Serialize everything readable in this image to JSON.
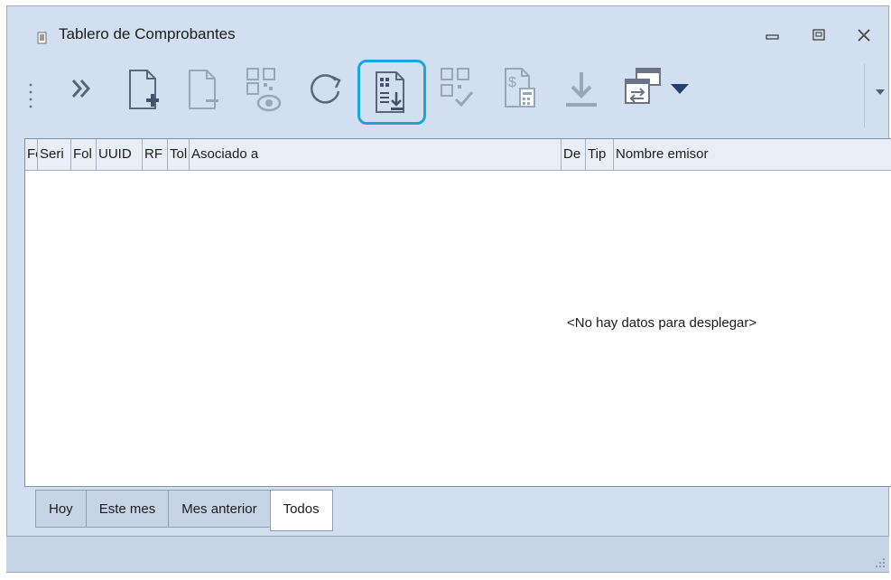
{
  "window": {
    "title": "Tablero de Comprobantes",
    "controls": [
      "minimize-icon",
      "maximize-icon",
      "close-icon"
    ]
  },
  "toolbar": {
    "buttons": [
      {
        "id": "more",
        "icon": "chevron-double-right-icon"
      },
      {
        "id": "new-document",
        "icon": "new-document-icon"
      },
      {
        "id": "cancel-document",
        "icon": "remove-document-icon"
      },
      {
        "id": "view-qr",
        "icon": "qr-view-icon"
      },
      {
        "id": "refresh",
        "icon": "refresh-icon"
      },
      {
        "id": "download-document",
        "icon": "document-download-icon",
        "highlighted": true
      },
      {
        "id": "validate-qr",
        "icon": "qr-check-icon"
      },
      {
        "id": "payment-document",
        "icon": "payment-calculator-icon"
      },
      {
        "id": "download",
        "icon": "download-icon"
      },
      {
        "id": "export-window",
        "icon": "window-transfer-icon"
      },
      {
        "id": "dropdown",
        "icon": "caret-down-icon"
      }
    ],
    "highlight_color": "#1aa6d8"
  },
  "grid": {
    "columns": [
      "Fe",
      "Seri",
      "Fol",
      "UUID",
      "RF",
      "Tol",
      "Asociado a",
      "De",
      "Tip",
      "Nombre emisor"
    ],
    "empty_message": "<No hay datos para desplegar>"
  },
  "tabs": [
    "Hoy",
    "Este mes",
    "Mes anterior",
    "Todos"
  ],
  "active_tab": "Todos"
}
